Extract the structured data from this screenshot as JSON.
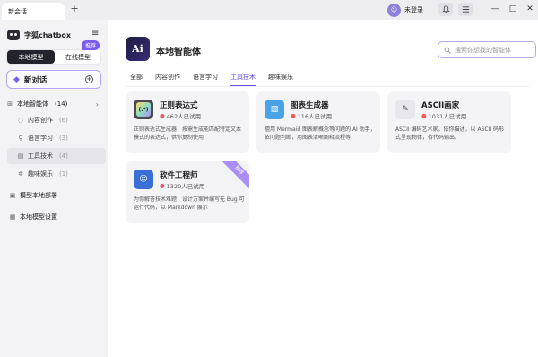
{
  "window": {
    "tab_title": "新会话",
    "tab_add": "+",
    "login_label": "未登录",
    "login_avatar": "☺",
    "controls": {
      "minimize": "—",
      "maximize": "□",
      "close": "✕"
    }
  },
  "sidebar": {
    "brand": "字狐chatbox",
    "modes": {
      "local": "本地模型",
      "online": "在线模型",
      "badge": "推荐"
    },
    "new_chat": "新对话",
    "agents_header": "本地智能体",
    "agents_count": "(14)",
    "categories": [
      {
        "label": "内容创作",
        "count": "(6)"
      },
      {
        "label": "语言学习",
        "count": "(3)"
      },
      {
        "label": "工具技术",
        "count": "(4)"
      },
      {
        "label": "趣味娱乐",
        "count": "(1)"
      }
    ],
    "deploy_link": "模型本地部署",
    "settings_link": "本地模型设置"
  },
  "main": {
    "logo_text": "Ai",
    "title": "本地智能体",
    "search_placeholder": "搜索你想找的智能体",
    "tabs": [
      "全部",
      "内容创作",
      "语言学习",
      "工具技术",
      "趣味娱乐"
    ],
    "active_tab": 3,
    "cards": [
      {
        "title": "正则表达式",
        "uses": "462人已试用",
        "icon": "(.*)",
        "icon_bg": "#4a4a4f",
        "desc": "正则表达式生成器，按需生成能匹配特定文本模式的表达式，供你复制使用"
      },
      {
        "title": "图表生成器",
        "uses": "116人已试用",
        "icon": "▧",
        "icon_bg": "#4aa3e8",
        "desc": "擅用 Mermaid 图表解概念等问题的 AI 助手，依问题判断，用图表清晰阐释流程等"
      },
      {
        "title": "ASCII画家",
        "uses": "1031人已试用",
        "icon": "✎",
        "icon_bg": "#e8e8ec",
        "desc": "ASCII 编码艺术家，依你描述，以 ASCII 码形式呈现物体，待代码输出。"
      },
      {
        "title": "软件工程师",
        "uses": "1320人已试用",
        "icon": "☺",
        "icon_bg": "#3a6fd8",
        "desc": "为你解答技术难题，设计方案并编写无 Bug 可运行代码，以 Markdown 展示",
        "ribbon": "推荐"
      }
    ]
  }
}
